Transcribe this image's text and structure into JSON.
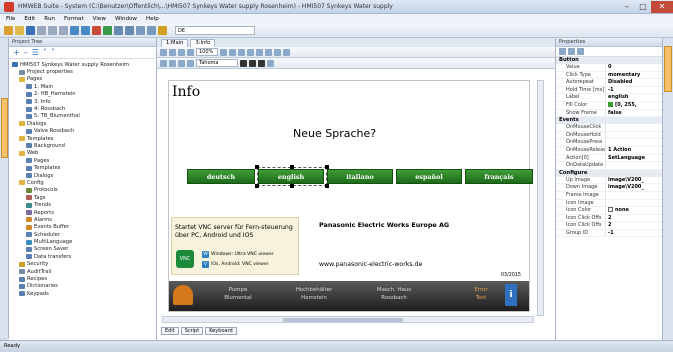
{
  "window": {
    "title": "HMWEB Suite - System (C:\\Benutzer\\Öffentlich\\...\\HMI507 Synkeys Water supply Rosenheim) - HMI507 Synkeys Water supply",
    "min_label": "–",
    "max_label": "□",
    "close_label": "✕"
  },
  "menu": [
    "File",
    "Edit",
    "Run",
    "Format",
    "View",
    "Window",
    "Help"
  ],
  "toolbar": {
    "font_select": "DE"
  },
  "project_panel": {
    "title": "Project Tree",
    "tools": [
      "+",
      "–",
      "☰",
      "˄",
      "˅"
    ],
    "tree": [
      {
        "indent": 0,
        "label": "HMI507 Synkeys Water supply Rosenheim",
        "icon": "project-icon",
        "color": "#3b6fb6"
      },
      {
        "indent": 1,
        "label": "Project properties",
        "icon": "properties-icon",
        "color": "#7a8aa0"
      },
      {
        "indent": 1,
        "label": "Pages",
        "icon": "folder-icon",
        "color": "#e2b341"
      },
      {
        "indent": 2,
        "label": "1: Main",
        "icon": "page-icon",
        "color": "#5b7fb0"
      },
      {
        "indent": 2,
        "label": "2: HB_Hamstein",
        "icon": "page-icon",
        "color": "#5b7fb0"
      },
      {
        "indent": 2,
        "label": "3: Info",
        "icon": "page-icon",
        "color": "#5b7fb0"
      },
      {
        "indent": 2,
        "label": "4: Rossbach",
        "icon": "page-icon",
        "color": "#5b7fb0"
      },
      {
        "indent": 2,
        "label": "5: TB_Blumenthal",
        "icon": "page-icon",
        "color": "#5b7fb0"
      },
      {
        "indent": 1,
        "label": "Dialogs",
        "icon": "folder-icon",
        "color": "#e2b341"
      },
      {
        "indent": 2,
        "label": "Valve Rossbach",
        "icon": "dialog-icon",
        "color": "#5b7fb0"
      },
      {
        "indent": 1,
        "label": "Templates",
        "icon": "folder-icon",
        "color": "#e2b341"
      },
      {
        "indent": 2,
        "label": "Background",
        "icon": "template-icon",
        "color": "#5b7fb0"
      },
      {
        "indent": 1,
        "label": "Web",
        "icon": "folder-icon",
        "color": "#e2b341"
      },
      {
        "indent": 2,
        "label": "Pages",
        "icon": "page-icon",
        "color": "#5b7fb0"
      },
      {
        "indent": 2,
        "label": "Templates",
        "icon": "template-icon",
        "color": "#5b7fb0"
      },
      {
        "indent": 2,
        "label": "Dialogs",
        "icon": "dialog-icon",
        "color": "#5b7fb0"
      },
      {
        "indent": 1,
        "label": "Config",
        "icon": "folder-icon",
        "color": "#e2b341"
      },
      {
        "indent": 2,
        "label": "Protocols",
        "icon": "protocol-icon",
        "color": "#6a8a3a"
      },
      {
        "indent": 2,
        "label": "Tags",
        "icon": "tag-icon",
        "color": "#b05b5b"
      },
      {
        "indent": 2,
        "label": "Trends",
        "icon": "trend-icon",
        "color": "#3a8a8a"
      },
      {
        "indent": 2,
        "label": "Reports",
        "icon": "report-icon",
        "color": "#7a6aa0"
      },
      {
        "indent": 2,
        "label": "Alarms",
        "icon": "alarm-icon",
        "color": "#d08a2a"
      },
      {
        "indent": 2,
        "label": "Events Buffer",
        "icon": "event-icon",
        "color": "#d08a2a"
      },
      {
        "indent": 2,
        "label": "Scheduler",
        "icon": "scheduler-icon",
        "color": "#5b7fb0"
      },
      {
        "indent": 2,
        "label": "MultiLanguage",
        "icon": "language-icon",
        "color": "#3a8ac0"
      },
      {
        "indent": 2,
        "label": "Screen Saver",
        "icon": "screensaver-icon",
        "color": "#5b7fb0"
      },
      {
        "indent": 2,
        "label": "Data transfers",
        "icon": "transfer-icon",
        "color": "#5b7fb0"
      },
      {
        "indent": 1,
        "label": "Security",
        "icon": "lock-icon",
        "color": "#d0a020"
      },
      {
        "indent": 1,
        "label": "AuditTrail",
        "icon": "audit-icon",
        "color": "#7a8aa0"
      },
      {
        "indent": 1,
        "label": "Recipes",
        "icon": "recipe-icon",
        "color": "#5b7fb0"
      },
      {
        "indent": 1,
        "label": "Dictionaries",
        "icon": "dictionary-icon",
        "color": "#5b7fb0"
      },
      {
        "indent": 1,
        "label": "Keypads",
        "icon": "keypad-icon",
        "color": "#5b7fb0"
      }
    ]
  },
  "editor": {
    "tabs": [
      "1:Main",
      "3:Info"
    ],
    "zoom": "100%",
    "font": "Tahoma",
    "page_title": "Info",
    "question": "Neue Sprache?",
    "languages": [
      "deutsch",
      "english",
      "italiano",
      "español",
      "français"
    ],
    "vnc_text": "Startet VNC server für Fern-steuerung über PC, Android und IOS",
    "vnc_logo": "VNC",
    "vnc_windows": "Windows: Ultra VNC viewer",
    "vnc_ios": "IOs, Android: VNC viewer",
    "company": "Panasonic Electric Works Europe AG",
    "url": "www.panasonic-electric-works.de",
    "date": "03/2015",
    "nav": [
      {
        "line1": "Pumpe",
        "line2": "Blumental"
      },
      {
        "line1": "Hochbehälter",
        "line2": "Hamstein"
      },
      {
        "line1": "Masch. Haus",
        "line2": "Rossbach"
      },
      {
        "line1": "Error",
        "line2": "Test"
      }
    ],
    "info_glyph": "i",
    "bottom_tabs": [
      "Edit",
      "Script",
      "Keyboard"
    ]
  },
  "properties": {
    "title": "Properties",
    "sections": [
      {
        "name": "Button",
        "rows": [
          {
            "k": "Value",
            "v": "0"
          },
          {
            "k": "Click Type",
            "v": "momentary"
          },
          {
            "k": "Autorepeat",
            "v": "Disabled"
          },
          {
            "k": "Hold Time [ms]",
            "v": "-1"
          },
          {
            "k": "Label",
            "v": "english"
          },
          {
            "k": "Fill Color",
            "v": "[0, 255,",
            "swatch": "#3a9a2e"
          },
          {
            "k": "Show Frame",
            "v": "false"
          }
        ]
      },
      {
        "name": "Events",
        "rows": [
          {
            "k": "OnMouseClick",
            "v": ""
          },
          {
            "k": "OnMouseHold",
            "v": ""
          },
          {
            "k": "OnMousePress",
            "v": ""
          },
          {
            "k": "OnMouseRelease",
            "v": "1 Action"
          },
          {
            "k": "Action[0]",
            "v": "SetLanguage"
          },
          {
            "k": "OnDataUpdate",
            "v": ""
          }
        ]
      },
      {
        "name": "Configure",
        "rows": [
          {
            "k": "Up Image",
            "v": "image\\V200_"
          },
          {
            "k": "Down Image",
            "v": "image\\V200_"
          },
          {
            "k": "Frame Image",
            "v": ""
          },
          {
            "k": "Icon Image",
            "v": ""
          },
          {
            "k": "Icon Color",
            "v": "none",
            "check": true
          },
          {
            "k": "Icon Click Offs",
            "v": "2"
          },
          {
            "k": "Icon Click Offs",
            "v": "2"
          },
          {
            "k": "Group ID",
            "v": "-1"
          }
        ]
      }
    ]
  },
  "status": {
    "left": "Ready"
  }
}
